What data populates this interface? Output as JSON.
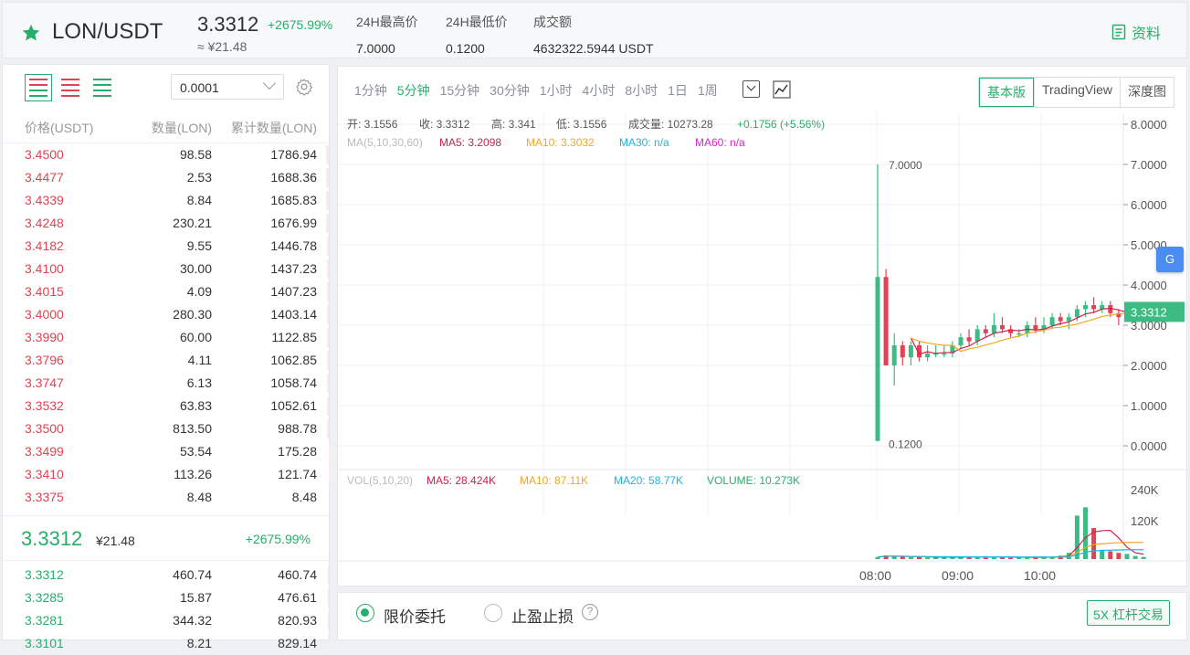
{
  "header": {
    "pair": "LON/USDT",
    "price": "3.3312",
    "change": "+2675.99%",
    "cny": "≈ ¥21.48",
    "stats": [
      {
        "label": "24H最高价",
        "value": "7.0000"
      },
      {
        "label": "24H最低价",
        "value": "0.1200"
      },
      {
        "label": "成交额",
        "value": "4632322.5944 USDT"
      }
    ],
    "profile_label": "资料"
  },
  "orderbook": {
    "precision": "0.0001",
    "columns": [
      "价格(USDT)",
      "数量(LON)",
      "累计数量(LON)"
    ],
    "asks": [
      {
        "price": "3.4500",
        "qty": "98.58",
        "total": "1786.94"
      },
      {
        "price": "3.4477",
        "qty": "2.53",
        "total": "1688.36"
      },
      {
        "price": "3.4339",
        "qty": "8.84",
        "total": "1685.83"
      },
      {
        "price": "3.4248",
        "qty": "230.21",
        "total": "1676.99"
      },
      {
        "price": "3.4182",
        "qty": "9.55",
        "total": "1446.78"
      },
      {
        "price": "3.4100",
        "qty": "30.00",
        "total": "1437.23"
      },
      {
        "price": "3.4015",
        "qty": "4.09",
        "total": "1407.23"
      },
      {
        "price": "3.4000",
        "qty": "280.30",
        "total": "1403.14"
      },
      {
        "price": "3.3990",
        "qty": "60.00",
        "total": "1122.85"
      },
      {
        "price": "3.3796",
        "qty": "4.11",
        "total": "1062.85"
      },
      {
        "price": "3.3747",
        "qty": "6.13",
        "total": "1058.74"
      },
      {
        "price": "3.3532",
        "qty": "63.83",
        "total": "1052.61"
      },
      {
        "price": "3.3500",
        "qty": "813.50",
        "total": "988.78"
      },
      {
        "price": "3.3499",
        "qty": "53.54",
        "total": "175.28"
      },
      {
        "price": "3.3410",
        "qty": "113.26",
        "total": "121.74"
      },
      {
        "price": "3.3375",
        "qty": "8.48",
        "total": "8.48"
      }
    ],
    "last_price": "3.3312",
    "last_cny": "¥21.48",
    "last_change": "+2675.99%",
    "bids": [
      {
        "price": "3.3312",
        "qty": "460.74",
        "total": "460.74"
      },
      {
        "price": "3.3285",
        "qty": "15.87",
        "total": "476.61"
      },
      {
        "price": "3.3281",
        "qty": "344.32",
        "total": "820.93"
      },
      {
        "price": "3.3101",
        "qty": "8.21",
        "total": "829.14"
      }
    ]
  },
  "chart_toolbar": {
    "periods": [
      "1分钟",
      "5分钟",
      "15分钟",
      "30分钟",
      "1小时",
      "4小时",
      "8小时",
      "1日",
      "1周"
    ],
    "active_period": "5分钟",
    "views": [
      "基本版",
      "TradingView",
      "深度图"
    ],
    "active_view": "基本版"
  },
  "chart_data": {
    "type": "candlestick",
    "info_line": {
      "open_label": "开: 3.1556",
      "close_label": "收: 3.3312",
      "high_label": "高: 3.341",
      "low_label": "低: 3.1556",
      "vol_label": "成交量: 10273.28",
      "change_label": "+0.1756 (+5.56%)"
    },
    "ma_line": {
      "label": "MA(5,10,30,60)",
      "ma5": "MA5: 3.2098",
      "ma10": "MA10: 3.3032",
      "ma30": "MA30: n/a",
      "ma60": "MA60: n/a"
    },
    "vol_line": {
      "label": "VOL(5,10,20)",
      "ma5": "MA5: 28.424K",
      "ma10": "MA10: 87.11K",
      "ma20": "MA20: 58.77K",
      "volume": "VOLUME: 10.273K"
    },
    "y_ticks": [
      "8.0000",
      "7.0000",
      "6.0000",
      "5.0000",
      "4.0000",
      "3.0000",
      "2.0000",
      "1.0000",
      "0.0000"
    ],
    "y_range": [
      0,
      8
    ],
    "vol_ticks": [
      "240K",
      "120K"
    ],
    "x_ticks": [
      "08:00",
      "09:00",
      "10:00"
    ],
    "current_price_tag": "3.3312",
    "high_marker": "7.0000",
    "low_marker": "0.1200",
    "colors": {
      "up": "#3cbc82",
      "down": "#e04352",
      "ma5": "#c9224b",
      "ma10": "#f5a623",
      "ma20": "#1cb5e0"
    },
    "candles": [
      {
        "o": 0.12,
        "h": 7.0,
        "l": 0.12,
        "c": 4.2
      },
      {
        "o": 4.2,
        "h": 4.4,
        "l": 2.0,
        "c": 2.0
      },
      {
        "o": 2.0,
        "h": 2.8,
        "l": 1.5,
        "c": 2.5
      },
      {
        "o": 2.5,
        "h": 2.6,
        "l": 2.0,
        "c": 2.2
      },
      {
        "o": 2.2,
        "h": 2.6,
        "l": 2.0,
        "c": 2.5
      },
      {
        "o": 2.5,
        "h": 2.6,
        "l": 2.1,
        "c": 2.2
      },
      {
        "o": 2.2,
        "h": 2.5,
        "l": 2.1,
        "c": 2.3
      },
      {
        "o": 2.3,
        "h": 2.5,
        "l": 2.2,
        "c": 2.3
      },
      {
        "o": 2.3,
        "h": 2.5,
        "l": 2.2,
        "c": 2.3
      },
      {
        "o": 2.3,
        "h": 2.6,
        "l": 2.2,
        "c": 2.5
      },
      {
        "o": 2.5,
        "h": 2.8,
        "l": 2.4,
        "c": 2.7
      },
      {
        "o": 2.7,
        "h": 2.9,
        "l": 2.5,
        "c": 2.6
      },
      {
        "o": 2.6,
        "h": 3.0,
        "l": 2.5,
        "c": 2.9
      },
      {
        "o": 2.9,
        "h": 3.0,
        "l": 2.7,
        "c": 2.8
      },
      {
        "o": 2.8,
        "h": 3.3,
        "l": 2.7,
        "c": 3.0
      },
      {
        "o": 3.0,
        "h": 3.2,
        "l": 2.8,
        "c": 2.9
      },
      {
        "o": 2.9,
        "h": 3.0,
        "l": 2.7,
        "c": 2.8
      },
      {
        "o": 2.8,
        "h": 2.9,
        "l": 2.7,
        "c": 2.8
      },
      {
        "o": 2.8,
        "h": 3.1,
        "l": 2.7,
        "c": 3.0
      },
      {
        "o": 3.0,
        "h": 3.2,
        "l": 2.8,
        "c": 2.9
      },
      {
        "o": 2.9,
        "h": 3.2,
        "l": 2.8,
        "c": 3.0
      },
      {
        "o": 3.0,
        "h": 3.3,
        "l": 2.9,
        "c": 3.2
      },
      {
        "o": 3.2,
        "h": 3.3,
        "l": 3.0,
        "c": 3.1
      },
      {
        "o": 3.1,
        "h": 3.3,
        "l": 2.9,
        "c": 3.2
      },
      {
        "o": 3.2,
        "h": 3.5,
        "l": 3.1,
        "c": 3.4
      },
      {
        "o": 3.4,
        "h": 3.6,
        "l": 3.2,
        "c": 3.5
      },
      {
        "o": 3.5,
        "h": 3.7,
        "l": 3.3,
        "c": 3.4
      },
      {
        "o": 3.4,
        "h": 3.6,
        "l": 3.3,
        "c": 3.5
      },
      {
        "o": 3.5,
        "h": 3.6,
        "l": 3.2,
        "c": 3.3
      },
      {
        "o": 3.3,
        "h": 3.4,
        "l": 3.0,
        "c": 3.2
      },
      {
        "o": 3.2,
        "h": 3.3,
        "l": 3.1,
        "c": 3.2
      },
      {
        "o": 3.2,
        "h": 3.3,
        "l": 3.1,
        "c": 3.2
      },
      {
        "o": 3.1556,
        "h": 3.341,
        "l": 3.1556,
        "c": 3.3312
      }
    ],
    "volumes": [
      10,
      18,
      14,
      12,
      10,
      10,
      8,
      9,
      8,
      10,
      12,
      9,
      10,
      8,
      11,
      9,
      8,
      7,
      9,
      8,
      10,
      12,
      16,
      30,
      210,
      250,
      150,
      45,
      38,
      30,
      25,
      15,
      10.273
    ],
    "vol_max": 300
  },
  "order_panel": {
    "limit_label": "限价委托",
    "stop_label": "止盈止损",
    "leverage_label": "5X 杠杆交易"
  },
  "translate_icon_text": "G"
}
